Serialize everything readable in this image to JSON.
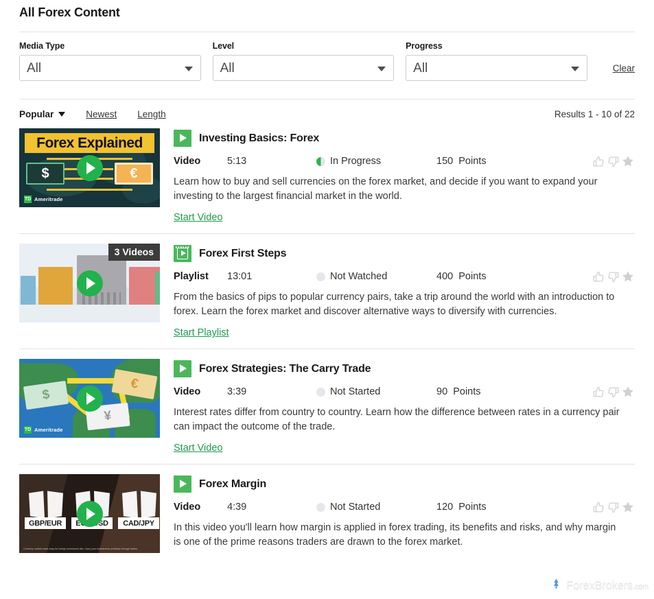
{
  "header": {
    "title": "All Forex Content"
  },
  "filters": {
    "clear_label": "Clear",
    "groups": [
      {
        "label": "Media Type",
        "value": "All",
        "icon": "chevron-down-icon"
      },
      {
        "label": "Level",
        "value": "All",
        "icon": "chevron-down-icon"
      },
      {
        "label": "Progress",
        "value": "All",
        "icon": "chevron-down-icon"
      }
    ]
  },
  "sortbar": {
    "active": "Popular",
    "links": [
      "Newest",
      "Length"
    ],
    "results": "Results 1 - 10 of 22"
  },
  "rows": [
    {
      "title": "Investing Basics: Forex",
      "type_icon": "play-icon",
      "media_type": "Video",
      "duration": "5:13",
      "status": "In Progress",
      "status_state": "inprogress",
      "points": "150",
      "points_label": "Points",
      "description": "Learn how to buy and sell currencies on the forex market, and decide if you want to expand your investing to the largest financial market in the world.",
      "action": "Start Video",
      "thumb": {
        "style": "t1",
        "banner": "Forex Explained",
        "left_currency": "$",
        "right_currency": "€",
        "brand_mark": "TD",
        "brand_text": "Ameritrade"
      }
    },
    {
      "title": "Forex First Steps",
      "type_icon": "playlist-icon",
      "media_type": "Playlist",
      "duration": "13:01",
      "status": "Not Watched",
      "status_state": "notstarted",
      "points": "400",
      "points_label": "Points",
      "description": "From the basics of pips to popular currency pairs, take a trip around the world with an introduction to forex. Learn the forex market and discover alternative ways to diversify with currencies.",
      "action": "Start Playlist",
      "thumb": {
        "style": "t2",
        "badge": "3 Videos"
      }
    },
    {
      "title": "Forex Strategies: The Carry Trade",
      "type_icon": "play-icon",
      "media_type": "Video",
      "duration": "3:39",
      "status": "Not Started",
      "status_state": "notstarted",
      "points": "90",
      "points_label": "Points",
      "description": "Interest rates differ from country to country. Learn how the difference between rates in a currency pair can impact the outcome of the trade.",
      "action": "Start Video",
      "thumb": {
        "style": "t3",
        "bill_a": "$",
        "bill_b": "€",
        "bill_c": "¥",
        "brand_mark": "TD",
        "brand_text": "Ameritrade"
      }
    },
    {
      "title": "Forex Margin",
      "type_icon": "play-icon",
      "media_type": "Video",
      "duration": "4:39",
      "status": "Not Started",
      "status_state": "notstarted",
      "points": "120",
      "points_label": "Points",
      "description": "In this video you'll learn how margin is applied in forex trading, its benefits and risks, and why margin is one of the prime reasons traders are drawn to the forex market.",
      "action": "",
      "thumb": {
        "style": "t4",
        "crest_1": "GBP/EUR",
        "crest_2": "EUR/USD",
        "crest_3": "CAD/JPY",
        "disclaimer": "Currency market made easy for foreign investment risk. Carry your investments profitably through trades."
      }
    }
  ],
  "watermark": {
    "name": "ForexBrokers",
    "suffix": ".com"
  },
  "ratings": {
    "thumbs_up": "thumbs-up-icon",
    "thumbs_down": "thumbs-down-icon",
    "star": "star-icon"
  }
}
